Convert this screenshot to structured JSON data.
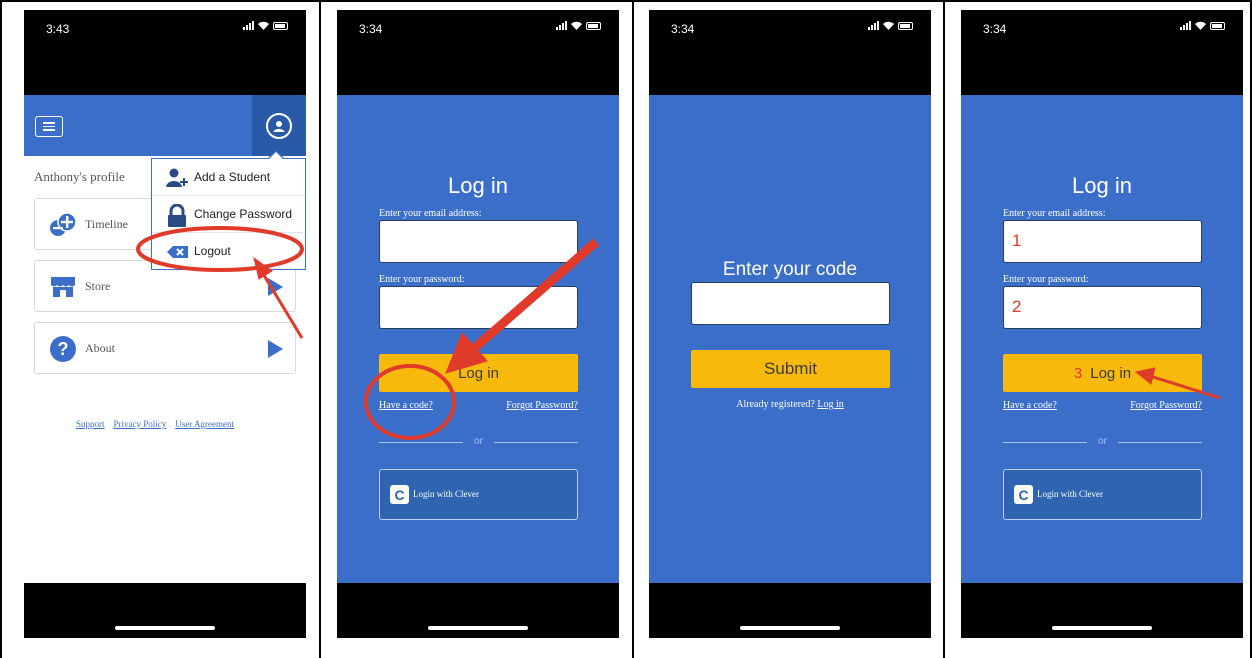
{
  "panels": [
    {
      "status_time": "3:43",
      "profile_title": "Anthony's profile",
      "menu_items": [
        {
          "label": "Timeline",
          "icon": "timeline-plus-icon"
        },
        {
          "label": "Store",
          "icon": "store-icon"
        },
        {
          "label": "About",
          "icon": "question-icon"
        }
      ],
      "footer_links": [
        "Support",
        "Privacy Policy",
        "User Agreement"
      ],
      "dropdown": [
        {
          "label": "Add a Student",
          "icon": "add-user-icon"
        },
        {
          "label": "Change Password",
          "icon": "lock-icon"
        },
        {
          "label": "Logout",
          "icon": "logout-icon"
        }
      ]
    },
    {
      "status_time": "3:34",
      "title": "Log in",
      "email_label": "Enter your email address:",
      "password_label": "Enter your password:",
      "email_value": "",
      "password_value": "",
      "login_button": "Log in",
      "have_code": "Have a code?",
      "forgot": "Forgot Password?",
      "or": "or",
      "clever": "Login with Clever"
    },
    {
      "status_time": "3:34",
      "title": "Enter your code",
      "code_value": "",
      "submit_button": "Submit",
      "registered_text": "Already registered?",
      "registered_link": "Log in"
    },
    {
      "status_time": "3:34",
      "title": "Log in",
      "email_label": "Enter your email address:",
      "password_label": "Enter your password:",
      "email_value": "1",
      "password_value": "2",
      "login_step": "3",
      "login_button": "Log in",
      "have_code": "Have a code?",
      "forgot": "Forgot Password?",
      "or": "or",
      "clever": "Login with Clever"
    }
  ],
  "colors": {
    "brand_blue": "#3b6ec8",
    "button_yellow": "#f7b90c",
    "annotation_red": "#e03a2a"
  }
}
